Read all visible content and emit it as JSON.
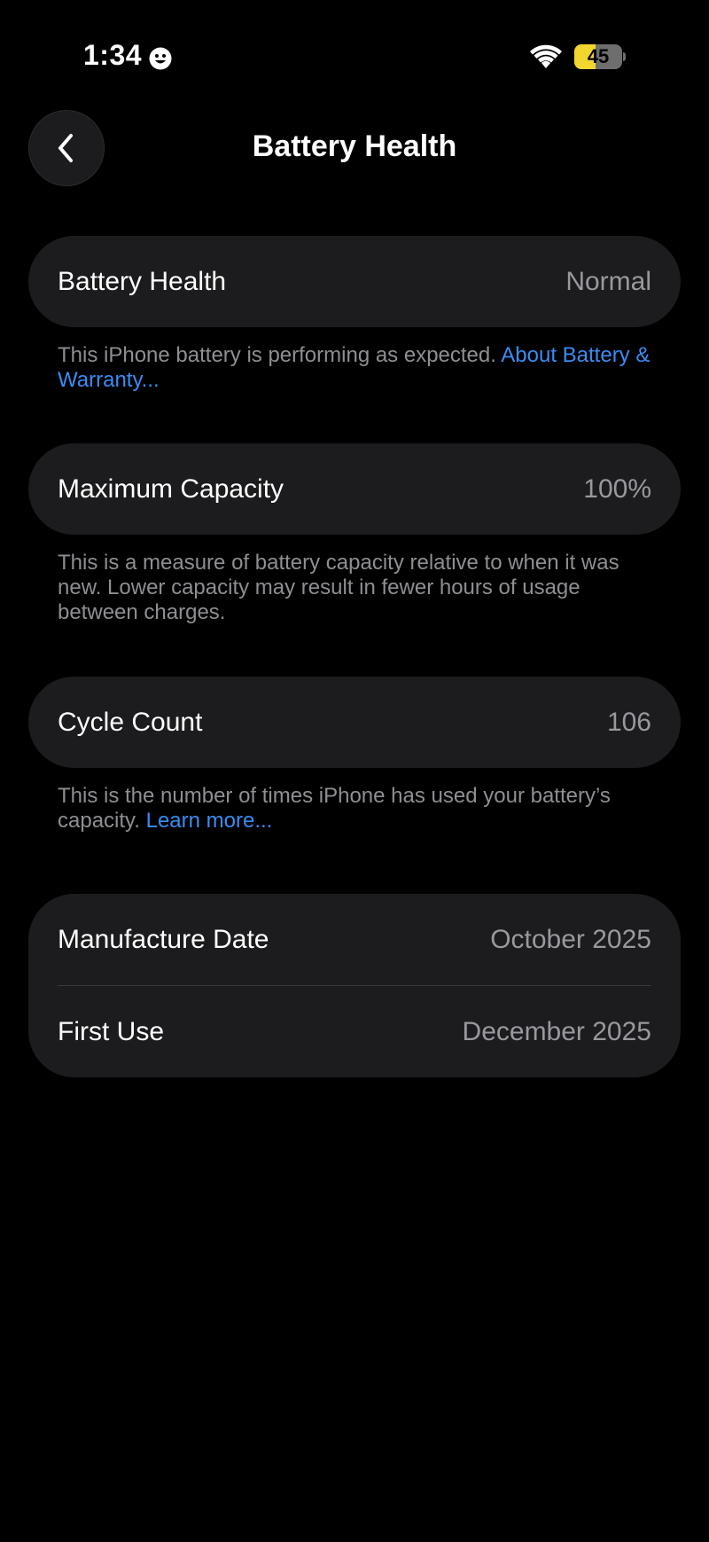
{
  "status_bar": {
    "time": "1:34",
    "battery_level": "45",
    "battery_fraction": 0.45,
    "icons": [
      "smiley-icon",
      "wifi-icon",
      "battery-icon"
    ],
    "battery_color": "#f2d630"
  },
  "nav": {
    "back_icon": "chevron-left-icon",
    "title": "Battery Health"
  },
  "sections": {
    "health": {
      "label": "Battery Health",
      "value": "Normal",
      "footnote": "This iPhone battery is performing as expected. ",
      "link": "About Battery & Warranty..."
    },
    "capacity": {
      "label": "Maximum Capacity",
      "value": "100%",
      "footnote": "This is a measure of battery capacity relative to when it was new. Lower capacity may result in fewer hours of usage between charges."
    },
    "cycles": {
      "label": "Cycle Count",
      "value": "106",
      "footnote": "This is the number of times iPhone has used your battery’s capacity. ",
      "link": "Learn more..."
    },
    "dates": {
      "manufacture_label": "Manufacture Date",
      "manufacture_value": "October 2025",
      "first_use_label": "First Use",
      "first_use_value": "December 2025"
    }
  },
  "colors": {
    "background": "#000000",
    "card": "#1c1c1e",
    "secondary_text": "#98989f",
    "link": "#3a8cf2"
  }
}
